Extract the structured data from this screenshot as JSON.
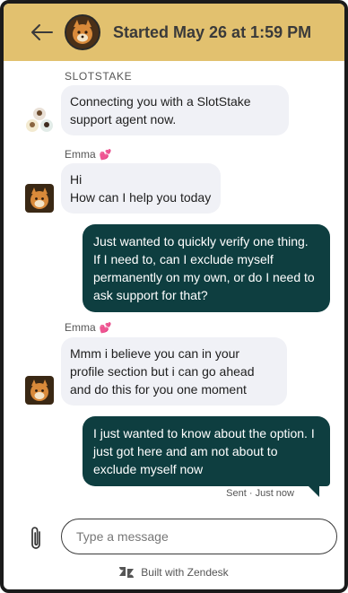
{
  "header": {
    "title": "Started May 26 at 1:59 PM",
    "back_icon": "arrow-left-icon",
    "background": "#e2c16f"
  },
  "messages": [
    {
      "sender": "SLOTSTAKE",
      "direction": "in",
      "avatar": "group-agents-avatar",
      "lines": [
        "Connecting you with a SlotStake",
        "support agent now."
      ]
    },
    {
      "sender": "Emma",
      "sender_badge": "💕",
      "direction": "in",
      "avatar": "emma-avatar",
      "lines": [
        "Hi",
        "How can I help you today"
      ]
    },
    {
      "direction": "out",
      "lines": [
        "Just wanted to quickly verify one thing.",
        "If I need to, can I exclude myself",
        "permanently on my own, or do I need to",
        "ask support for that?"
      ]
    },
    {
      "sender": "Emma",
      "sender_badge": "💕",
      "direction": "in",
      "avatar": "emma-avatar",
      "lines": [
        "Mmm i believe you can in your",
        "profile section but i can go ahead",
        "and do this for you one moment"
      ]
    },
    {
      "direction": "out",
      "lines": [
        "I just wanted to know about the option. I",
        "just got here and am not about to",
        "exclude myself now"
      ],
      "status": "Sent · Just now"
    }
  ],
  "composer": {
    "placeholder": "Type a message",
    "attach_icon": "paperclip-icon"
  },
  "footer": {
    "text": "Built with Zendesk",
    "icon": "zendesk-logo-icon"
  },
  "colors": {
    "outgoing_bubble": "#0e3e40",
    "incoming_bubble": "#f0f1f6",
    "header": "#e2c16f"
  }
}
